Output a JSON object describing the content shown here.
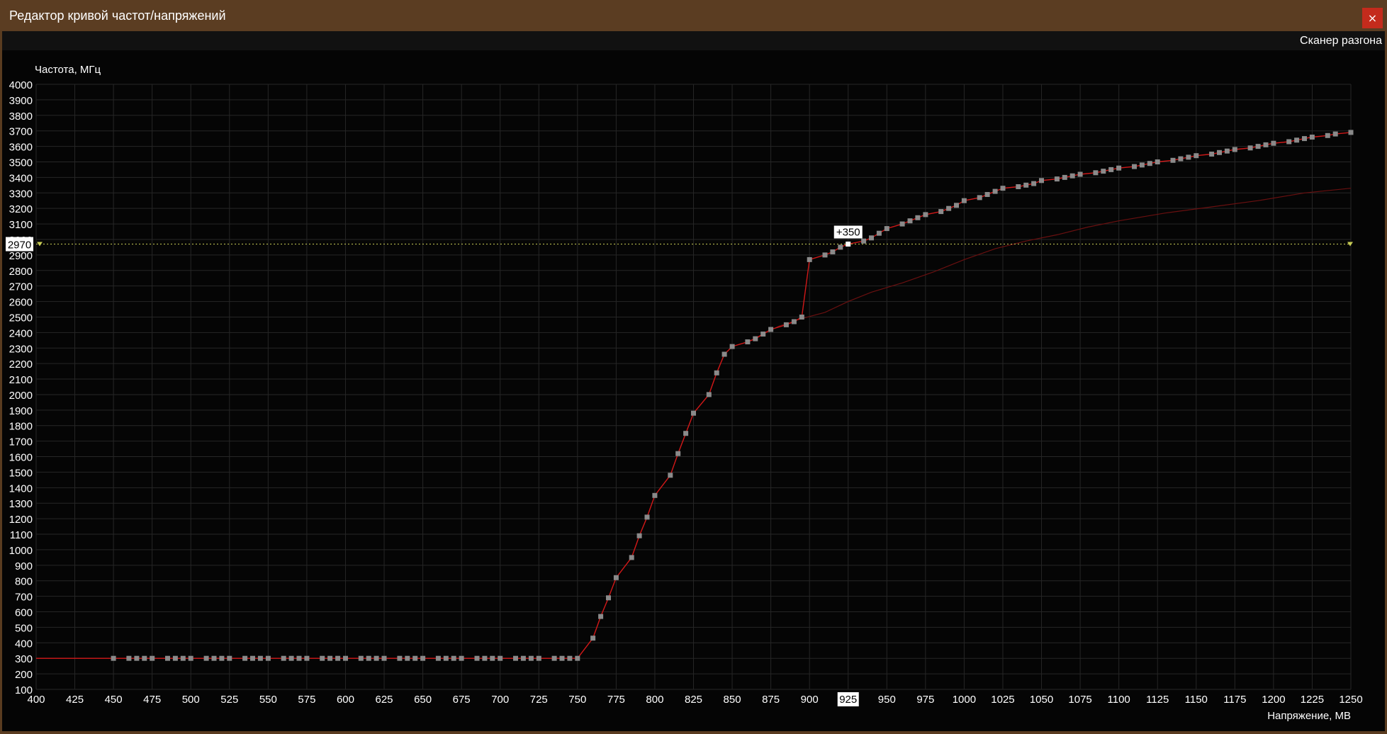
{
  "window": {
    "title": "Редактор кривой частот/напряжений",
    "close_icon": "×"
  },
  "menu": {
    "overclock_scanner": "Сканер разгона"
  },
  "colors": {
    "curve": "#d01818",
    "base_curve": "#6a1010",
    "points": "#8a8a8a",
    "selected_point": "#ffffff",
    "guide_line": "#c8cc55",
    "grid": "#262626",
    "window_frame": "#5b3d22"
  },
  "chart_data": {
    "type": "line",
    "title": "",
    "xlabel": "Напряжение, МВ",
    "ylabel": "Частота, МГц",
    "xlim": [
      400,
      1250
    ],
    "ylim": [
      100,
      4000
    ],
    "x_ticks": [
      400,
      425,
      450,
      475,
      500,
      525,
      550,
      575,
      600,
      625,
      650,
      675,
      700,
      725,
      750,
      775,
      800,
      825,
      850,
      875,
      900,
      925,
      950,
      975,
      1000,
      1025,
      1050,
      1075,
      1100,
      1125,
      1150,
      1175,
      1200,
      1225,
      1250
    ],
    "y_ticks": [
      100,
      200,
      300,
      400,
      500,
      600,
      700,
      800,
      900,
      1000,
      1100,
      1200,
      1300,
      1400,
      1500,
      1600,
      1700,
      1800,
      1900,
      2000,
      2100,
      2200,
      2300,
      2400,
      2500,
      2600,
      2700,
      2800,
      2900,
      3000,
      3100,
      3200,
      3300,
      3400,
      3500,
      3600,
      3700,
      3800,
      3900,
      4000
    ],
    "grid": true,
    "highlighted_x": 925,
    "highlighted_y": 2970,
    "offset_label": "+350",
    "series": [
      {
        "role": "edited-curve",
        "points": [
          [
            400,
            300
          ],
          [
            450,
            300
          ],
          [
            460,
            300
          ],
          [
            465,
            300
          ],
          [
            470,
            300
          ],
          [
            475,
            300
          ],
          [
            485,
            300
          ],
          [
            490,
            300
          ],
          [
            495,
            300
          ],
          [
            500,
            300
          ],
          [
            510,
            300
          ],
          [
            515,
            300
          ],
          [
            520,
            300
          ],
          [
            525,
            300
          ],
          [
            535,
            300
          ],
          [
            540,
            300
          ],
          [
            545,
            300
          ],
          [
            550,
            300
          ],
          [
            560,
            300
          ],
          [
            565,
            300
          ],
          [
            570,
            300
          ],
          [
            575,
            300
          ],
          [
            585,
            300
          ],
          [
            590,
            300
          ],
          [
            595,
            300
          ],
          [
            600,
            300
          ],
          [
            610,
            300
          ],
          [
            615,
            300
          ],
          [
            620,
            300
          ],
          [
            625,
            300
          ],
          [
            635,
            300
          ],
          [
            640,
            300
          ],
          [
            645,
            300
          ],
          [
            650,
            300
          ],
          [
            660,
            300
          ],
          [
            665,
            300
          ],
          [
            670,
            300
          ],
          [
            675,
            300
          ],
          [
            685,
            300
          ],
          [
            690,
            300
          ],
          [
            695,
            300
          ],
          [
            700,
            300
          ],
          [
            710,
            300
          ],
          [
            715,
            300
          ],
          [
            720,
            300
          ],
          [
            725,
            300
          ],
          [
            735,
            300
          ],
          [
            740,
            300
          ],
          [
            745,
            300
          ],
          [
            750,
            300
          ],
          [
            760,
            430
          ],
          [
            765,
            570
          ],
          [
            770,
            690
          ],
          [
            775,
            820
          ],
          [
            785,
            950
          ],
          [
            790,
            1090
          ],
          [
            795,
            1210
          ],
          [
            800,
            1350
          ],
          [
            810,
            1480
          ],
          [
            815,
            1620
          ],
          [
            820,
            1750
          ],
          [
            825,
            1880
          ],
          [
            835,
            2000
          ],
          [
            840,
            2140
          ],
          [
            845,
            2260
          ],
          [
            850,
            2310
          ],
          [
            860,
            2340
          ],
          [
            865,
            2360
          ],
          [
            870,
            2390
          ],
          [
            875,
            2420
          ],
          [
            885,
            2450
          ],
          [
            890,
            2470
          ],
          [
            895,
            2500
          ],
          [
            900,
            2870
          ],
          [
            910,
            2900
          ],
          [
            915,
            2920
          ],
          [
            920,
            2950
          ],
          [
            925,
            2970
          ],
          [
            935,
            2990
          ],
          [
            940,
            3010
          ],
          [
            945,
            3040
          ],
          [
            950,
            3070
          ],
          [
            960,
            3100
          ],
          [
            965,
            3120
          ],
          [
            970,
            3140
          ],
          [
            975,
            3160
          ],
          [
            985,
            3180
          ],
          [
            990,
            3200
          ],
          [
            995,
            3220
          ],
          [
            1000,
            3250
          ],
          [
            1010,
            3270
          ],
          [
            1015,
            3290
          ],
          [
            1020,
            3310
          ],
          [
            1025,
            3330
          ],
          [
            1035,
            3340
          ],
          [
            1040,
            3350
          ],
          [
            1045,
            3360
          ],
          [
            1050,
            3380
          ],
          [
            1060,
            3390
          ],
          [
            1065,
            3400
          ],
          [
            1070,
            3410
          ],
          [
            1075,
            3420
          ],
          [
            1085,
            3430
          ],
          [
            1090,
            3440
          ],
          [
            1095,
            3450
          ],
          [
            1100,
            3460
          ],
          [
            1110,
            3470
          ],
          [
            1115,
            3480
          ],
          [
            1120,
            3490
          ],
          [
            1125,
            3500
          ],
          [
            1135,
            3510
          ],
          [
            1140,
            3520
          ],
          [
            1145,
            3530
          ],
          [
            1150,
            3540
          ],
          [
            1160,
            3550
          ],
          [
            1165,
            3560
          ],
          [
            1170,
            3570
          ],
          [
            1175,
            3580
          ],
          [
            1185,
            3590
          ],
          [
            1190,
            3600
          ],
          [
            1195,
            3610
          ],
          [
            1200,
            3620
          ],
          [
            1210,
            3630
          ],
          [
            1215,
            3640
          ],
          [
            1220,
            3650
          ],
          [
            1225,
            3660
          ],
          [
            1235,
            3670
          ],
          [
            1240,
            3680
          ],
          [
            1250,
            3690
          ]
        ]
      },
      {
        "role": "base-curve",
        "points": [
          [
            400,
            300
          ],
          [
            750,
            300
          ],
          [
            760,
            430
          ],
          [
            765,
            570
          ],
          [
            770,
            690
          ],
          [
            775,
            820
          ],
          [
            785,
            950
          ],
          [
            790,
            1090
          ],
          [
            795,
            1210
          ],
          [
            800,
            1350
          ],
          [
            810,
            1480
          ],
          [
            815,
            1620
          ],
          [
            820,
            1750
          ],
          [
            825,
            1880
          ],
          [
            835,
            2000
          ],
          [
            840,
            2140
          ],
          [
            845,
            2260
          ],
          [
            850,
            2310
          ],
          [
            860,
            2340
          ],
          [
            870,
            2390
          ],
          [
            880,
            2440
          ],
          [
            895,
            2490
          ],
          [
            910,
            2530
          ],
          [
            925,
            2600
          ],
          [
            940,
            2660
          ],
          [
            960,
            2720
          ],
          [
            980,
            2790
          ],
          [
            1000,
            2870
          ],
          [
            1020,
            2940
          ],
          [
            1040,
            2990
          ],
          [
            1060,
            3030
          ],
          [
            1080,
            3080
          ],
          [
            1100,
            3120
          ],
          [
            1130,
            3170
          ],
          [
            1160,
            3210
          ],
          [
            1190,
            3250
          ],
          [
            1220,
            3300
          ],
          [
            1250,
            3330
          ]
        ]
      }
    ]
  }
}
